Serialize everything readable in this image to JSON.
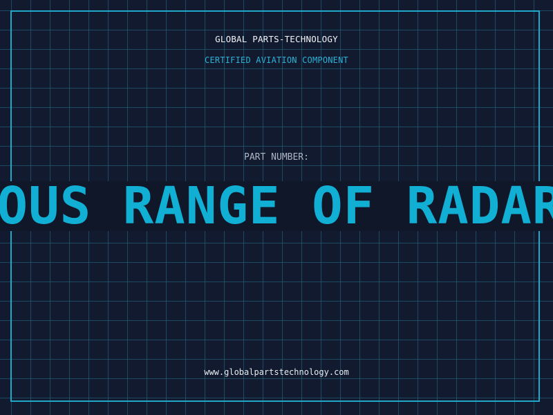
{
  "header": {
    "company": "GLOBAL PARTS-TECHNOLOGY",
    "subtitle": "CERTIFIED AVIATION COMPONENT"
  },
  "part": {
    "label": "PART NUMBER:",
    "value": "JOUS RANGE OF RADAR"
  },
  "footer": {
    "website": "www.globalpartstechnology.com"
  },
  "colors": {
    "background": "#111a2e",
    "accent": "#1fa8c8",
    "text": "#f2f4f8"
  }
}
